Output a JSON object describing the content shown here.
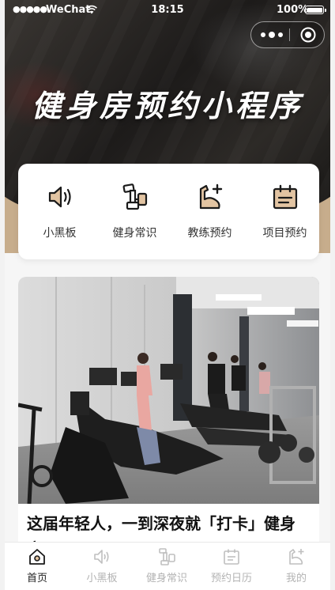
{
  "status_bar": {
    "signal": "●●●●●",
    "carrier": "WeChat",
    "time": "18:15",
    "battery": "100%"
  },
  "capsule": {
    "menu_icon": "more-dots-icon",
    "close_icon": "target-close-icon"
  },
  "hero": {
    "title": "健身房预约小程序"
  },
  "quick_nav": [
    {
      "label": "小黑板",
      "icon": "speaker-icon"
    },
    {
      "label": "健身常识",
      "icon": "dumbbell-icon"
    },
    {
      "label": "教练预约",
      "icon": "bicep-plus-icon"
    },
    {
      "label": "项目预约",
      "icon": "calendar-icon"
    }
  ],
  "news": {
    "title": "这届年轻人，一到深夜就「打卡」健身",
    "title_second_line": "房"
  },
  "tabbar": [
    {
      "label": "首页",
      "icon": "home-icon",
      "active": true
    },
    {
      "label": "小黑板",
      "icon": "speaker-icon",
      "active": false
    },
    {
      "label": "健身常识",
      "icon": "dumbbell-icon",
      "active": false
    },
    {
      "label": "预约日历",
      "icon": "calendar-icon",
      "active": false
    },
    {
      "label": "我的",
      "icon": "bicep-plus-icon",
      "active": false
    }
  ],
  "colors": {
    "accent": "#c7ad8c",
    "icon_fill": "#e2c4a2",
    "icon_stroke": "#1a1a1a",
    "tab_inactive": "#b3b3b3",
    "tab_active": "#222222"
  }
}
